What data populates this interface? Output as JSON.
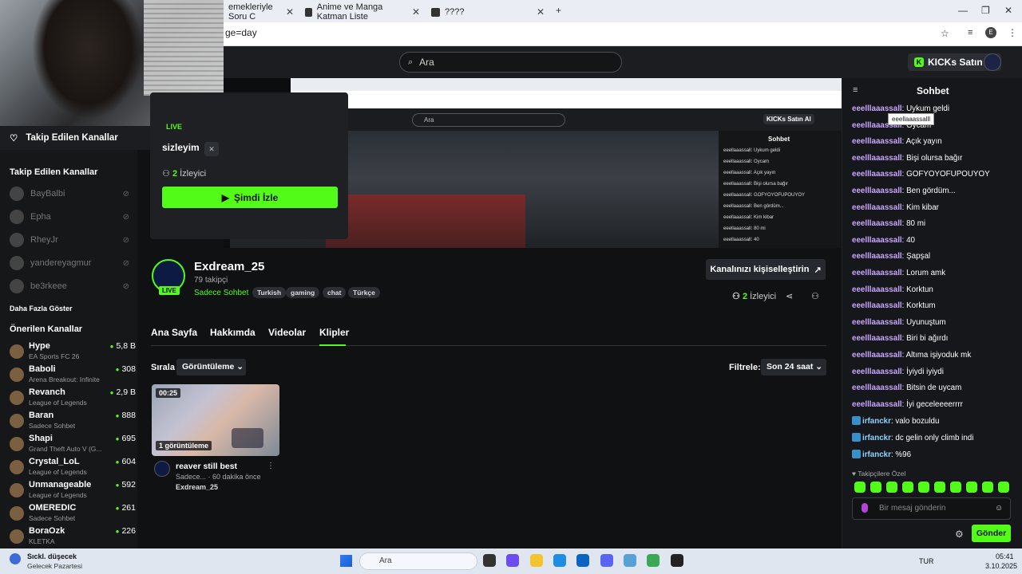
{
  "browser": {
    "tabs": [
      {
        "label": "emekleriyle Soru C"
      },
      {
        "label": "Anime ve Manga Katman Liste"
      },
      {
        "label": "????"
      }
    ],
    "address": "ge=day"
  },
  "header": {
    "search_placeholder": "Ara",
    "kicks_label": "KICKs Satın Al"
  },
  "sidebar": {
    "followed_bar": "Takip Edilen Kanallar",
    "followed_heading": "Takip Edilen Kanallar",
    "offline": [
      "BayBalbi",
      "Epha",
      "RheyJr",
      "yandereyagmur",
      "be3rkeee"
    ],
    "show_more": "Daha Fazla Göster",
    "recommended_heading": "Önerilen Kanallar",
    "recommended": [
      {
        "name": "Hype",
        "category": "EA Sports FC 26",
        "viewers": "5,8 B"
      },
      {
        "name": "Baboli",
        "category": "Arena Breakout: Infinite",
        "viewers": "308"
      },
      {
        "name": "Revanch",
        "category": "League of Legends",
        "viewers": "2,9 B"
      },
      {
        "name": "Baran",
        "category": "Sadece Sohbet",
        "viewers": "888"
      },
      {
        "name": "Shapi",
        "category": "Grand Theft Auto V (G...",
        "viewers": "695"
      },
      {
        "name": "Crystal_LoL",
        "category": "League of Legends",
        "viewers": "604"
      },
      {
        "name": "Unmanageable",
        "category": "League of Legends",
        "viewers": "592"
      },
      {
        "name": "OMEREDIC",
        "category": "Sadece Sohbet",
        "viewers": "261"
      },
      {
        "name": "BoraOzk",
        "category": "KLETKA",
        "viewers": "226"
      }
    ]
  },
  "popup": {
    "live": "LIVE",
    "title": "sizleyim",
    "viewers_count": "2",
    "viewers_label": "İzleyici",
    "watch_label": "Şimdi İzle"
  },
  "preview": {
    "search": "Ara",
    "kicks": "KICKs Satın Al",
    "chat_title": "Sohbet",
    "messages": [
      "eeellaaassall: Uykum geldi",
      "eeellaaassall: Oycam",
      "eeellaaassall: Açık yayın",
      "eeellaaassall: Bişi olursa bağır",
      "eeellaaassall: GOFYOYOFUPOUYOY",
      "eeellaaassall: Ben gördüm...",
      "eeellaaassall: Kim kibar",
      "eeellaaassall: 80 mi",
      "eeellaaassall: 40"
    ]
  },
  "channel": {
    "name": "Exdream_25",
    "followers": "79 takipçi",
    "category": "Sadece Sohbet",
    "live": "LIVE",
    "tags": [
      "Turkish",
      "gaming",
      "chat",
      "Türkçe"
    ],
    "customize": "Kanalınızı kişiselleştirin",
    "viewers_count": "2",
    "viewers_label": "İzleyici"
  },
  "tabs": [
    "Ana Sayfa",
    "Hakkımda",
    "Videolar",
    "Klipler"
  ],
  "sort": {
    "label": "Sırala",
    "value": "Görüntüleme"
  },
  "filter": {
    "label": "Filtrele:",
    "value": "Son 24 saat"
  },
  "clip": {
    "duration": "00:25",
    "views": "1 görüntüleme",
    "title": "reaver still best",
    "meta": "Sadece... · 60 dakika önce",
    "channel": "Exdream_25"
  },
  "chat": {
    "title": "Sohbet",
    "tooltip": "eeellaaassalll",
    "messages": [
      {
        "user": "eeelllaaassall",
        "text": "Uykum geldi"
      },
      {
        "user": "eeelllaaassall",
        "text": "Oycam"
      },
      {
        "user": "eeelllaaassall",
        "text": "Açık yayın"
      },
      {
        "user": "eeelllaaassall",
        "text": "Bişi olursa bağır"
      },
      {
        "user": "eeelllaaassall",
        "text": "GOFYOYOFUPOUYOY"
      },
      {
        "user": "eeelllaaassall",
        "text": "Ben gördüm..."
      },
      {
        "user": "eeelllaaassall",
        "text": "Kim kibar"
      },
      {
        "user": "eeelllaaassall",
        "text": "80 mi"
      },
      {
        "user": "eeelllaaassall",
        "text": "40"
      },
      {
        "user": "eeelllaaassall",
        "text": "Şapşal"
      },
      {
        "user": "eeelllaaassall",
        "text": "Lorum amk"
      },
      {
        "user": "eeelllaaassall",
        "text": "Korktun"
      },
      {
        "user": "eeelllaaassall",
        "text": "Korktum"
      },
      {
        "user": "eeelllaaassall",
        "text": "Uyunuştum"
      },
      {
        "user": "eeelllaaassall",
        "text": "Biri bi ağırdı"
      },
      {
        "user": "eeelllaaassall",
        "text": "Altıma işiyoduk mk"
      },
      {
        "user": "eeelllaaassall",
        "text": "İyiydi iyiydi"
      },
      {
        "user": "eeelllaaassall",
        "text": "Bitsin de uycam"
      },
      {
        "user": "eeelllaaassall",
        "text": "İyi geceleeeerrrr"
      },
      {
        "user": "irfanckr",
        "text": "valo bozuldu"
      },
      {
        "user": "irfanckr",
        "text": "dc gelin only climb indi"
      },
      {
        "user": "irfanckr",
        "text": "%96"
      }
    ],
    "sub_label": "♥ Takipçilere Özel",
    "input_placeholder": "Bir mesaj gönderin",
    "send": "Gönder"
  },
  "taskbar": {
    "weather_title": "Sıckl. düşecek",
    "weather_sub": "Gelecek Pazartesi",
    "search": "Ara",
    "lang": "TUR",
    "time": "05:41",
    "date": "3.10.2025"
  },
  "colors": {
    "accent": "#53fc18",
    "username": "#c9a6ff"
  }
}
